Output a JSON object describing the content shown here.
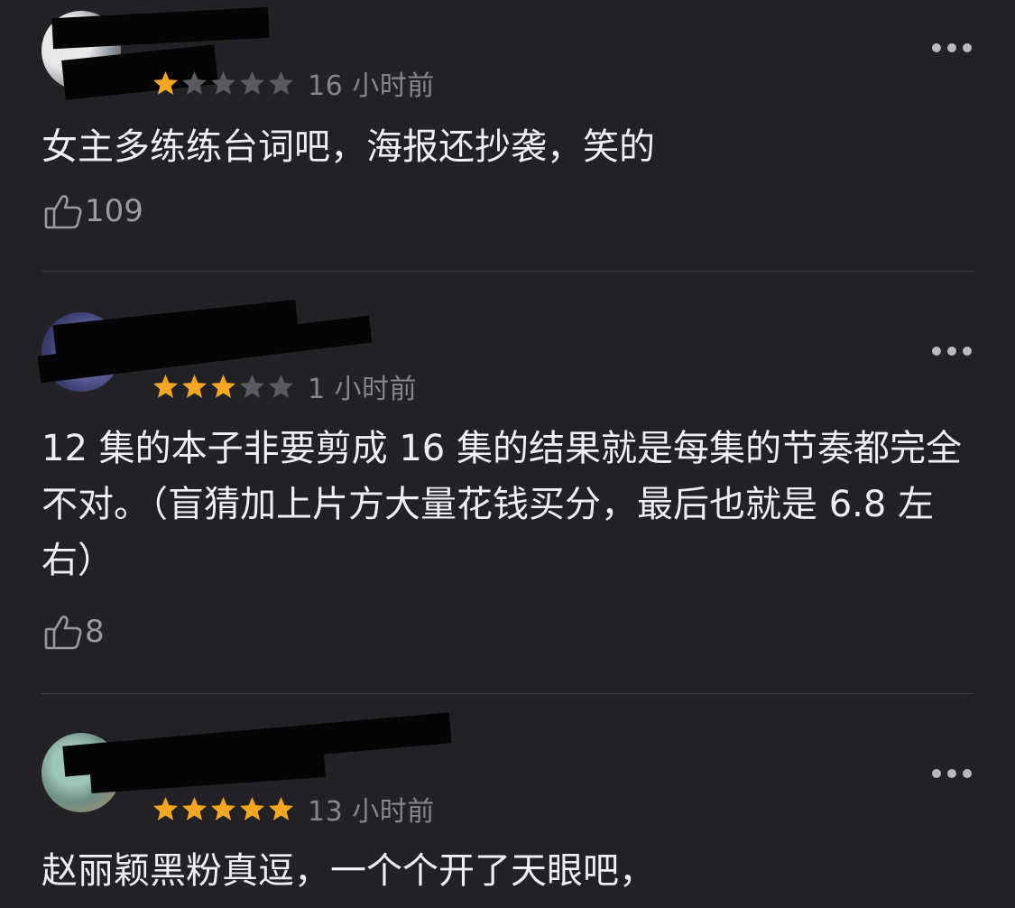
{
  "colors": {
    "background": "#222226",
    "star_active": "#f5a623",
    "star_inactive": "#5a5a60",
    "text": "#efeff2",
    "muted": "#86868c"
  },
  "reviews": [
    {
      "rating": 1,
      "time": "16 小时前",
      "text": "女主多练练台词吧，海报还抄袭，笑的",
      "likes": "109",
      "like_icon": "thumbs-up-icon",
      "more_icon": "more-dots-icon"
    },
    {
      "rating": 3,
      "time": "1 小时前",
      "text": "12 集的本子非要剪成 16 集的结果就是每集的节奏都完全不对。（盲猜加上片方大量花钱买分，最后也就是 6.8 左右）",
      "likes": "8",
      "like_icon": "thumbs-up-icon",
      "more_icon": "more-dots-icon"
    },
    {
      "rating": 5,
      "time": "13 小时前",
      "text": "赵丽颖黑粉真逗，一个个开了天眼吧，",
      "likes": "",
      "like_icon": "thumbs-up-icon",
      "more_icon": "more-dots-icon"
    }
  ]
}
